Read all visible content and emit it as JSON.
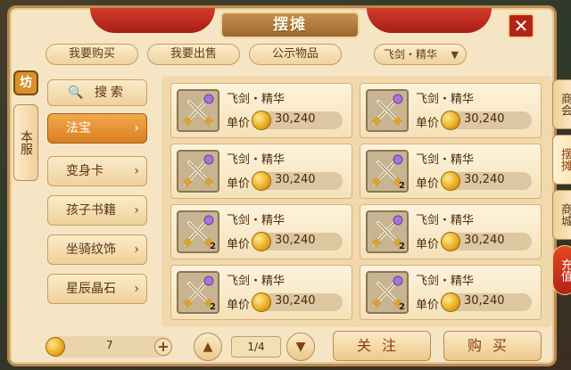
{
  "title": "摆摊",
  "close_label": "✕",
  "tabs": [
    {
      "label": "我要购买"
    },
    {
      "label": "我要出售"
    },
    {
      "label": "公示物品"
    }
  ],
  "filter": {
    "selected": "飞剑・精华"
  },
  "left_panel": {
    "shop_badge": "坊",
    "server_tab": "本服",
    "search_label": "搜索",
    "categories": [
      {
        "label": "法宝",
        "active": true
      },
      {
        "label": "变身卡",
        "active": false
      },
      {
        "label": "孩子书籍",
        "active": false
      },
      {
        "label": "坐骑纹饰",
        "active": false
      },
      {
        "label": "星辰晶石",
        "active": false
      }
    ]
  },
  "items": [
    {
      "name": "飞剑・精华",
      "price_label": "单价",
      "price": "30,240",
      "qty": ""
    },
    {
      "name": "飞剑・精华",
      "price_label": "单价",
      "price": "30,240",
      "qty": ""
    },
    {
      "name": "飞剑・精华",
      "price_label": "单价",
      "price": "30,240",
      "qty": ""
    },
    {
      "name": "飞剑・精华",
      "price_label": "单价",
      "price": "30,240",
      "qty": "2"
    },
    {
      "name": "飞剑・精华",
      "price_label": "单价",
      "price": "30,240",
      "qty": "2"
    },
    {
      "name": "飞剑・精华",
      "price_label": "单价",
      "price": "30,240",
      "qty": "2"
    },
    {
      "name": "飞剑・精华",
      "price_label": "单价",
      "price": "30,240",
      "qty": "2"
    },
    {
      "name": "飞剑・精华",
      "price_label": "单价",
      "price": "30,240",
      "qty": "2"
    }
  ],
  "bottom": {
    "money": "7",
    "plus": "+",
    "page": "1/4",
    "follow_label": "关注",
    "buy_label": "购买"
  },
  "side_tabs": [
    {
      "label": "商会"
    },
    {
      "label": "摆摊"
    },
    {
      "label": "商城"
    },
    {
      "label": "充值"
    }
  ],
  "colors": {
    "panel_bg": "#f6e5c5",
    "accent_orange": "#d97f22",
    "ribbon_red": "#b32318",
    "coin_gold": "#e8a91e"
  }
}
